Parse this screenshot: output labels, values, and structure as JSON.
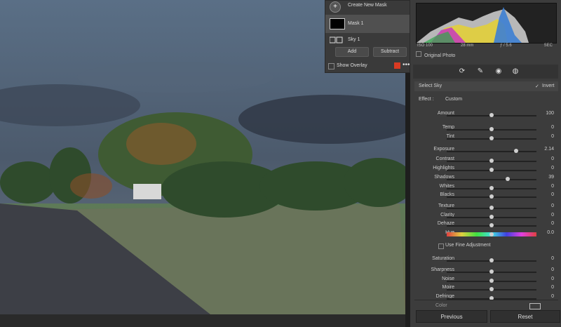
{
  "mask_panel": {
    "create_label": "Create New Mask",
    "mask1_label": "Mask 1",
    "sky1_label": "Sky 1",
    "add_label": "Add",
    "subtract_label": "Subtract",
    "overlay_label": "Show Overlay",
    "overlay_color": "#d93a22"
  },
  "histogram": {
    "iso": "ISO 100",
    "focal": "28 mm",
    "aperture": "ƒ / 5.6",
    "shutter": "SEC",
    "original_photo": "Original Photo"
  },
  "panel": {
    "select_sky": "Select Sky",
    "invert": "Invert",
    "effect_label": "Effect :",
    "effect_value": "Custom",
    "hue_label": "Hue",
    "hue_value": "0.0",
    "fine_adjust": "Use Fine Adjustment",
    "color_label": "Color"
  },
  "sliders": [
    {
      "name": "Amount",
      "value": "100",
      "pos": 0.5
    },
    {
      "name": "Temp",
      "value": "0",
      "pos": 0.5
    },
    {
      "name": "Tint",
      "value": "0",
      "pos": 0.5
    },
    {
      "name": "Exposure",
      "value": "2.14",
      "pos": 0.77
    },
    {
      "name": "Contrast",
      "value": "0",
      "pos": 0.5
    },
    {
      "name": "Highlights",
      "value": "0",
      "pos": 0.5
    },
    {
      "name": "Shadows",
      "value": "39",
      "pos": 0.68
    },
    {
      "name": "Whites",
      "value": "0",
      "pos": 0.5
    },
    {
      "name": "Blacks",
      "value": "0",
      "pos": 0.5
    },
    {
      "name": "Texture",
      "value": "0",
      "pos": 0.5
    },
    {
      "name": "Clarity",
      "value": "0",
      "pos": 0.5
    },
    {
      "name": "Dehaze",
      "value": "0",
      "pos": 0.5
    },
    {
      "name": "Saturation",
      "value": "0",
      "pos": 0.5
    },
    {
      "name": "Sharpness",
      "value": "0",
      "pos": 0.5
    },
    {
      "name": "Noise",
      "value": "0",
      "pos": 0.5
    },
    {
      "name": "Moire",
      "value": "0",
      "pos": 0.5
    },
    {
      "name": "Defringe",
      "value": "0",
      "pos": 0.5
    }
  ],
  "footer": {
    "previous": "Previous",
    "reset": "Reset"
  }
}
